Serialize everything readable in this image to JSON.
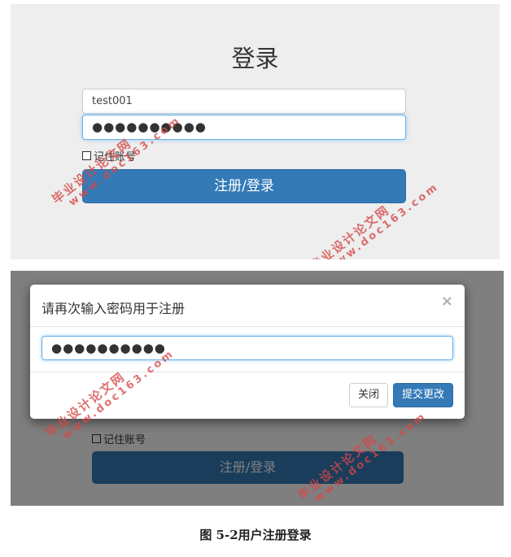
{
  "login": {
    "title": "登录",
    "username_value": "test001",
    "password_mask": "●●●●●●●●●●",
    "remember_label": "记住账号",
    "submit_label": "注册/登录"
  },
  "modal": {
    "title": "请再次输入密码用于注册",
    "close_glyph": "×",
    "password_mask": "●●●●●●●●●●",
    "close_button": "关闭",
    "submit_button": "提交更改"
  },
  "background_form": {
    "remember_label": "记住账号",
    "submit_label": "注册/登录"
  },
  "watermark": {
    "line1": "毕业设计论文网",
    "line2": "www.doc163.com",
    "color": "#d64848"
  },
  "caption": "图 5-2用户注册登录",
  "colors": {
    "primary": "#337ab7",
    "panel_bg": "#eeeeee",
    "focus_border": "#66afe9"
  }
}
